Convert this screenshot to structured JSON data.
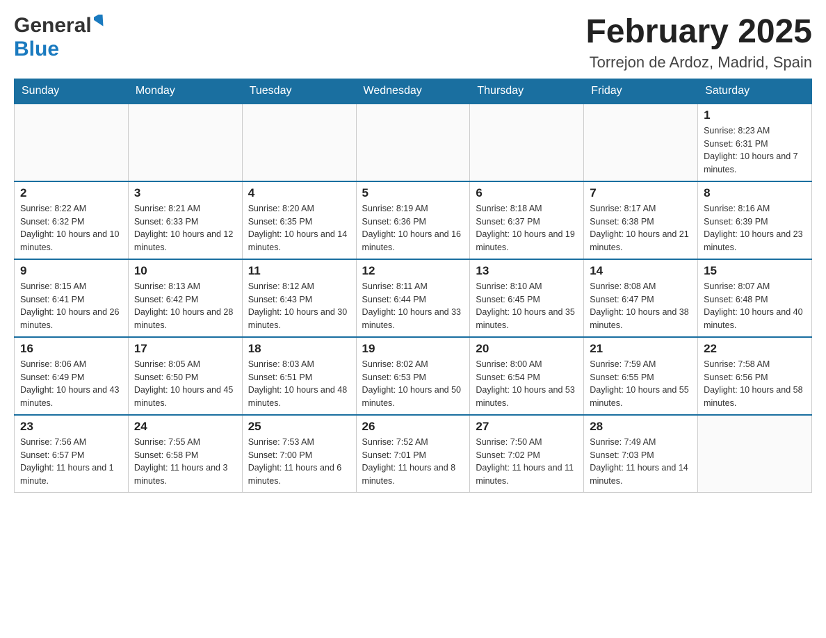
{
  "header": {
    "logo_general": "General",
    "logo_blue": "Blue",
    "title": "February 2025",
    "subtitle": "Torrejon de Ardoz, Madrid, Spain"
  },
  "days_of_week": [
    "Sunday",
    "Monday",
    "Tuesday",
    "Wednesday",
    "Thursday",
    "Friday",
    "Saturday"
  ],
  "weeks": [
    {
      "days": [
        {
          "number": "",
          "info": ""
        },
        {
          "number": "",
          "info": ""
        },
        {
          "number": "",
          "info": ""
        },
        {
          "number": "",
          "info": ""
        },
        {
          "number": "",
          "info": ""
        },
        {
          "number": "",
          "info": ""
        },
        {
          "number": "1",
          "info": "Sunrise: 8:23 AM\nSunset: 6:31 PM\nDaylight: 10 hours and 7 minutes."
        }
      ]
    },
    {
      "days": [
        {
          "number": "2",
          "info": "Sunrise: 8:22 AM\nSunset: 6:32 PM\nDaylight: 10 hours and 10 minutes."
        },
        {
          "number": "3",
          "info": "Sunrise: 8:21 AM\nSunset: 6:33 PM\nDaylight: 10 hours and 12 minutes."
        },
        {
          "number": "4",
          "info": "Sunrise: 8:20 AM\nSunset: 6:35 PM\nDaylight: 10 hours and 14 minutes."
        },
        {
          "number": "5",
          "info": "Sunrise: 8:19 AM\nSunset: 6:36 PM\nDaylight: 10 hours and 16 minutes."
        },
        {
          "number": "6",
          "info": "Sunrise: 8:18 AM\nSunset: 6:37 PM\nDaylight: 10 hours and 19 minutes."
        },
        {
          "number": "7",
          "info": "Sunrise: 8:17 AM\nSunset: 6:38 PM\nDaylight: 10 hours and 21 minutes."
        },
        {
          "number": "8",
          "info": "Sunrise: 8:16 AM\nSunset: 6:39 PM\nDaylight: 10 hours and 23 minutes."
        }
      ]
    },
    {
      "days": [
        {
          "number": "9",
          "info": "Sunrise: 8:15 AM\nSunset: 6:41 PM\nDaylight: 10 hours and 26 minutes."
        },
        {
          "number": "10",
          "info": "Sunrise: 8:13 AM\nSunset: 6:42 PM\nDaylight: 10 hours and 28 minutes."
        },
        {
          "number": "11",
          "info": "Sunrise: 8:12 AM\nSunset: 6:43 PM\nDaylight: 10 hours and 30 minutes."
        },
        {
          "number": "12",
          "info": "Sunrise: 8:11 AM\nSunset: 6:44 PM\nDaylight: 10 hours and 33 minutes."
        },
        {
          "number": "13",
          "info": "Sunrise: 8:10 AM\nSunset: 6:45 PM\nDaylight: 10 hours and 35 minutes."
        },
        {
          "number": "14",
          "info": "Sunrise: 8:08 AM\nSunset: 6:47 PM\nDaylight: 10 hours and 38 minutes."
        },
        {
          "number": "15",
          "info": "Sunrise: 8:07 AM\nSunset: 6:48 PM\nDaylight: 10 hours and 40 minutes."
        }
      ]
    },
    {
      "days": [
        {
          "number": "16",
          "info": "Sunrise: 8:06 AM\nSunset: 6:49 PM\nDaylight: 10 hours and 43 minutes."
        },
        {
          "number": "17",
          "info": "Sunrise: 8:05 AM\nSunset: 6:50 PM\nDaylight: 10 hours and 45 minutes."
        },
        {
          "number": "18",
          "info": "Sunrise: 8:03 AM\nSunset: 6:51 PM\nDaylight: 10 hours and 48 minutes."
        },
        {
          "number": "19",
          "info": "Sunrise: 8:02 AM\nSunset: 6:53 PM\nDaylight: 10 hours and 50 minutes."
        },
        {
          "number": "20",
          "info": "Sunrise: 8:00 AM\nSunset: 6:54 PM\nDaylight: 10 hours and 53 minutes."
        },
        {
          "number": "21",
          "info": "Sunrise: 7:59 AM\nSunset: 6:55 PM\nDaylight: 10 hours and 55 minutes."
        },
        {
          "number": "22",
          "info": "Sunrise: 7:58 AM\nSunset: 6:56 PM\nDaylight: 10 hours and 58 minutes."
        }
      ]
    },
    {
      "days": [
        {
          "number": "23",
          "info": "Sunrise: 7:56 AM\nSunset: 6:57 PM\nDaylight: 11 hours and 1 minute."
        },
        {
          "number": "24",
          "info": "Sunrise: 7:55 AM\nSunset: 6:58 PM\nDaylight: 11 hours and 3 minutes."
        },
        {
          "number": "25",
          "info": "Sunrise: 7:53 AM\nSunset: 7:00 PM\nDaylight: 11 hours and 6 minutes."
        },
        {
          "number": "26",
          "info": "Sunrise: 7:52 AM\nSunset: 7:01 PM\nDaylight: 11 hours and 8 minutes."
        },
        {
          "number": "27",
          "info": "Sunrise: 7:50 AM\nSunset: 7:02 PM\nDaylight: 11 hours and 11 minutes."
        },
        {
          "number": "28",
          "info": "Sunrise: 7:49 AM\nSunset: 7:03 PM\nDaylight: 11 hours and 14 minutes."
        },
        {
          "number": "",
          "info": ""
        }
      ]
    }
  ]
}
